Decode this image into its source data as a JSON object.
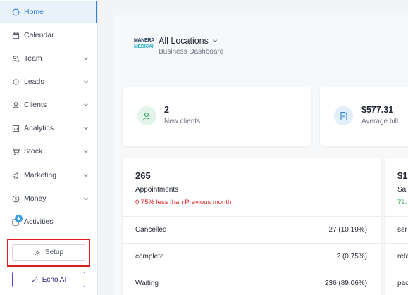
{
  "sidebar": {
    "items": [
      {
        "label": "Home",
        "icon": "home-icon",
        "active": true
      },
      {
        "label": "Calendar",
        "icon": "calendar-icon"
      },
      {
        "label": "Team",
        "icon": "team-icon"
      },
      {
        "label": "Leads",
        "icon": "leads-icon"
      },
      {
        "label": "Clients",
        "icon": "client-icon"
      },
      {
        "label": "Analytics",
        "icon": "analytics-icon"
      },
      {
        "label": "Stock",
        "icon": "cart-icon"
      },
      {
        "label": "Marketing",
        "icon": "megaphone-icon"
      },
      {
        "label": "Money",
        "icon": "dollar-icon"
      },
      {
        "label": "Activities",
        "icon": "activities-icon"
      }
    ],
    "setup_label": "Setup",
    "echo_label": "Echo AI"
  },
  "header": {
    "logo_line1": "MANERA",
    "logo_line2": "MEDICAI",
    "location": "All Locations",
    "subtitle": "Business Dashboard"
  },
  "stats": [
    {
      "value": "2",
      "label": "New clients",
      "icon": "new-client-icon"
    },
    {
      "value": "$577.31",
      "label": "Average bill",
      "icon": "bill-icon"
    }
  ],
  "appointments": {
    "count": "265",
    "title": "Appointments",
    "change": "0.75% less than Previous month",
    "rows": [
      {
        "label": "Cancelled",
        "value": "27 (10.19%)"
      },
      {
        "label": "complete",
        "value": "2 (0.75%)"
      },
      {
        "label": "Waiting",
        "value": "236 (89.06%)"
      }
    ]
  },
  "sales": {
    "count": "$1",
    "title": "Sal",
    "change": "79.",
    "rows": [
      {
        "label": "ser"
      },
      {
        "label": "reta"
      },
      {
        "label": "pac"
      }
    ]
  },
  "colors": {
    "accent": "#2f7fd0",
    "negative": "#e02424",
    "positive": "#1e9e3a",
    "highlight": "#e11d1d"
  }
}
